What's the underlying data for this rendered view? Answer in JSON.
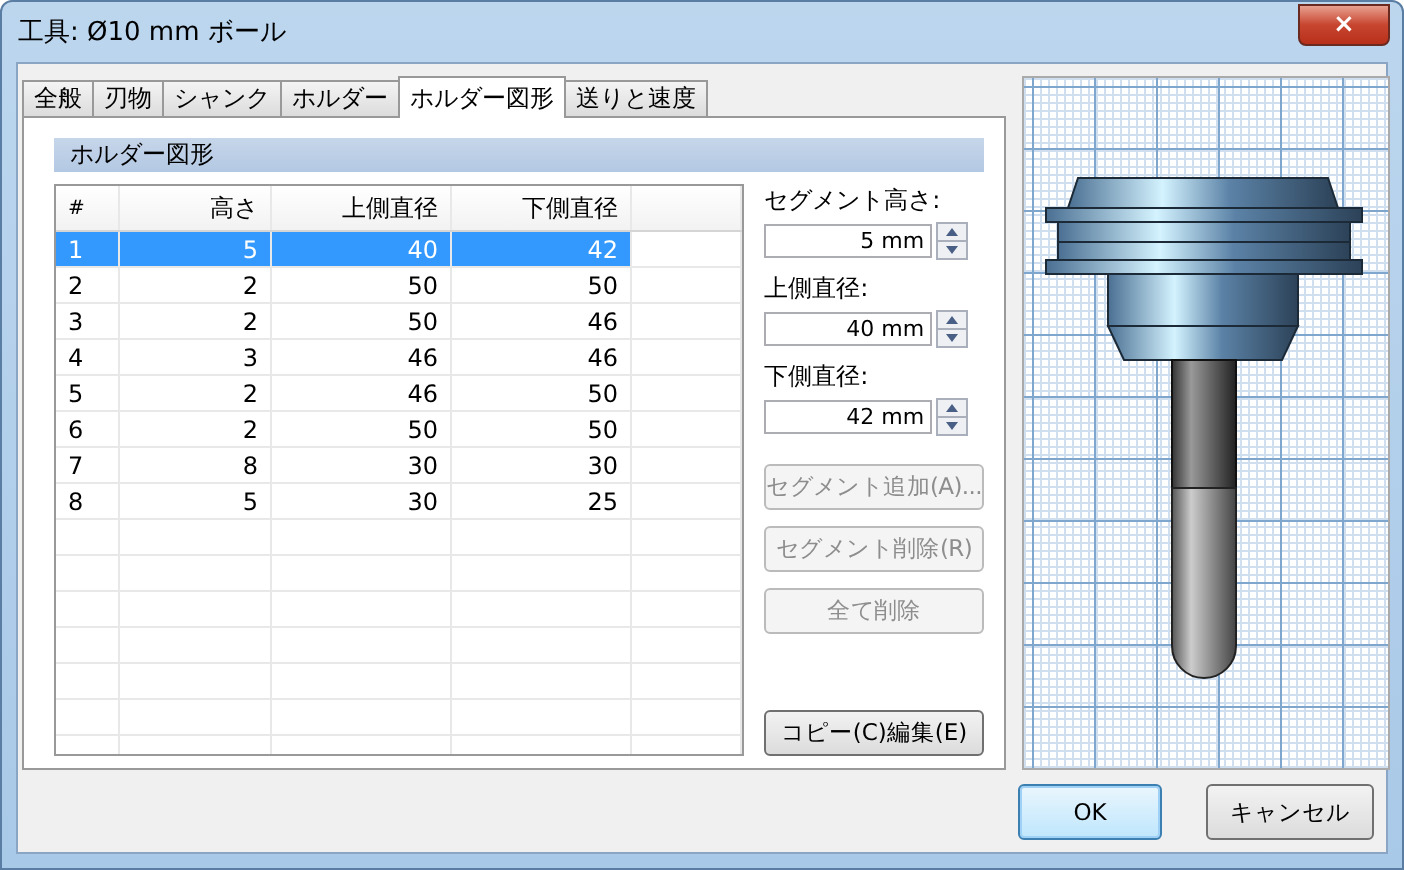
{
  "window": {
    "title": "工具: Ø10 mm ボール",
    "close": "×"
  },
  "tabs": [
    {
      "label": "全般",
      "selected": false
    },
    {
      "label": "刃物",
      "selected": false
    },
    {
      "label": "シャンク",
      "selected": false
    },
    {
      "label": "ホルダー",
      "selected": false
    },
    {
      "label": "ホルダー図形",
      "selected": true
    },
    {
      "label": "送りと速度",
      "selected": false
    }
  ],
  "section": {
    "title": "ホルダー図形"
  },
  "table": {
    "columns": [
      "#",
      "高さ",
      "上側直径",
      "下側直径"
    ],
    "rows": [
      {
        "cells": [
          "1",
          "5",
          "40",
          "42"
        ],
        "selected": true
      },
      {
        "cells": [
          "2",
          "2",
          "50",
          "50"
        ],
        "selected": false
      },
      {
        "cells": [
          "3",
          "2",
          "50",
          "46"
        ],
        "selected": false
      },
      {
        "cells": [
          "4",
          "3",
          "46",
          "46"
        ],
        "selected": false
      },
      {
        "cells": [
          "5",
          "2",
          "46",
          "50"
        ],
        "selected": false
      },
      {
        "cells": [
          "6",
          "2",
          "50",
          "50"
        ],
        "selected": false
      },
      {
        "cells": [
          "7",
          "8",
          "30",
          "30"
        ],
        "selected": false
      },
      {
        "cells": [
          "8",
          "5",
          "30",
          "25"
        ],
        "selected": false
      }
    ]
  },
  "fields": [
    {
      "label": "セグメント高さ:",
      "value": "5 mm"
    },
    {
      "label": "上側直径:",
      "value": "40 mm"
    },
    {
      "label": "下側直径:",
      "value": "42 mm"
    }
  ],
  "segment_buttons": [
    {
      "label": "セグメント追加(A)...",
      "disabled": true
    },
    {
      "label": "セグメント削除(R)",
      "disabled": true
    },
    {
      "label": "全て削除",
      "disabled": true
    }
  ],
  "copy_button": {
    "label": "コピー(C)編集(E)",
    "disabled": false
  },
  "dialog_buttons": [
    {
      "label": "OK",
      "default": true
    },
    {
      "label": "キャンセル",
      "default": false
    }
  ]
}
